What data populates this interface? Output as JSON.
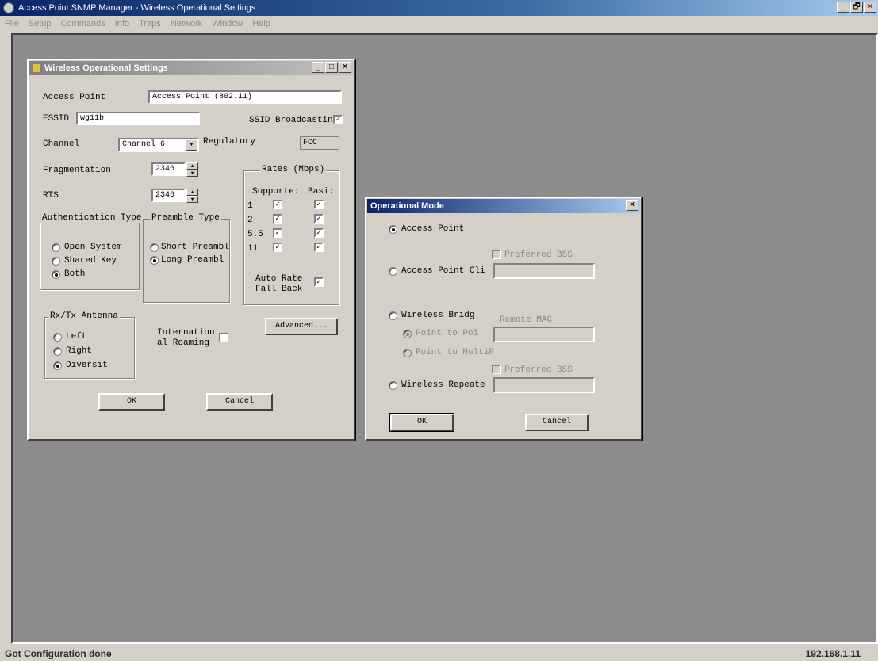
{
  "app": {
    "title": "Access Point SNMP Manager - Wireless Operational Settings",
    "window_controls": [
      "_",
      "🗗",
      "×"
    ]
  },
  "menu": [
    "File",
    "Setup",
    "Commands",
    "Info",
    "Traps",
    "Network",
    "Window",
    "Help"
  ],
  "status": {
    "message": "Got Configuration done",
    "ip": "192.168.1.11"
  },
  "wos": {
    "title": "Wireless Operational Settings",
    "controls": [
      "_",
      "□",
      "×"
    ],
    "access_point_label": "Access Point",
    "access_point_value": "Access Point (802.11)",
    "essid_label": "ESSID",
    "essid_value": "wg11b",
    "ssid_broadcast_label": "SSID Broadcastin",
    "channel_label": "Channel",
    "channel_value": "Channel 6",
    "regulatory_label": "Regulatory",
    "regulatory_value": "FCC",
    "fragmentation_label": "Fragmentation",
    "fragmentation_value": "2346",
    "rts_label": "RTS",
    "rts_value": "2346",
    "rates": {
      "title": "Rates (Mbps)",
      "supported_header": "Supporte:",
      "basic_header": "Basi:",
      "rows": [
        "1",
        "2",
        "5.5",
        "11"
      ],
      "auto_rate_label_1": "Auto Rate",
      "auto_rate_label_2": "Fall Back"
    },
    "auth": {
      "title": "Authentication Type",
      "options": [
        "Open System",
        "Shared Key",
        "Both"
      ],
      "selected": "Both"
    },
    "preamble": {
      "title": "Preamble Type",
      "options": [
        "Short Preambl",
        "Long Preambl"
      ],
      "selected": "Long Preambl"
    },
    "antenna": {
      "title": "Rx/Tx Antenna",
      "options": [
        "Left",
        "Right",
        "Diversit"
      ],
      "selected": "Diversit"
    },
    "roaming_label_1": "Internation",
    "roaming_label_2": "al Roaming",
    "advanced_label": "Advanced...",
    "ok_label": "OK",
    "cancel_label": "Cancel"
  },
  "opmode": {
    "title": "Operational Mode",
    "close": "×",
    "access_point": "Access Point",
    "access_point_client": "Access Point Cli",
    "preferred_bss_1": "Preferred BSS",
    "wireless_bridge": "Wireless Bridg",
    "remote_mac": "Remote MAC",
    "point_to_point": "Point to Poi",
    "point_to_multipoint": "Point to MultiP",
    "preferred_bss_2": "Preferred BSS",
    "wireless_repeater": "Wireless Repeate",
    "ok_label": "OK",
    "cancel_label": "Cancel"
  }
}
